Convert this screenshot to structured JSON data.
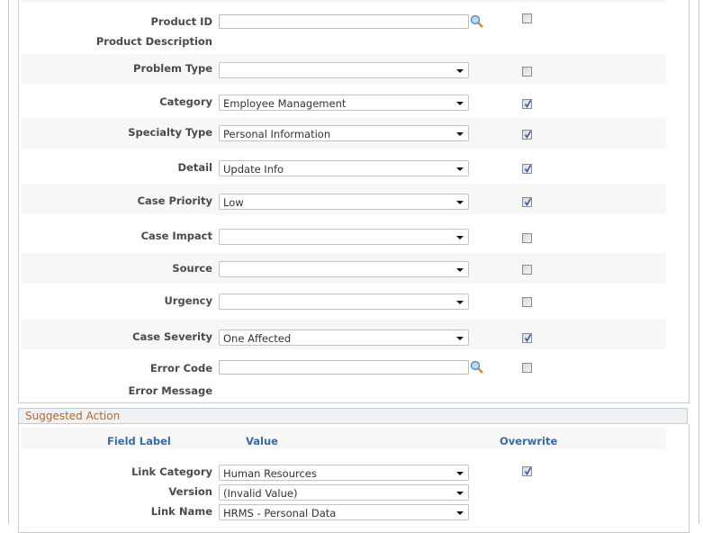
{
  "form": {
    "rows": [
      {
        "label": "Product ID",
        "type": "lookup",
        "value": "",
        "checked": false
      },
      {
        "label": "Product Description",
        "type": "text"
      },
      {
        "label": "Problem Type",
        "type": "select",
        "value": "",
        "checked": false
      },
      {
        "label": "Category",
        "type": "select",
        "value": "Employee Management",
        "checked": true
      },
      {
        "label": "Specialty Type",
        "type": "select",
        "value": "Personal Information",
        "checked": true
      },
      {
        "label": "Detail",
        "type": "select",
        "value": "Update Info",
        "checked": true
      },
      {
        "label": "Case Priority",
        "type": "select",
        "value": "Low",
        "checked": true
      },
      {
        "label": "Case Impact",
        "type": "select",
        "value": "",
        "checked": false
      },
      {
        "label": "Source",
        "type": "select",
        "value": "",
        "checked": false
      },
      {
        "label": "Urgency",
        "type": "select",
        "value": "",
        "checked": false
      },
      {
        "label": "Case Severity",
        "type": "select",
        "value": "One Affected",
        "checked": true
      },
      {
        "label": "Error Code",
        "type": "lookup",
        "value": "",
        "checked": false
      },
      {
        "label": "Error Message",
        "type": "text"
      }
    ]
  },
  "suggested_action": {
    "title": "Suggested Action",
    "columns": {
      "field_label": "Field Label",
      "value": "Value",
      "overwrite": "Overwrite"
    },
    "rows": [
      {
        "label": "Link Category",
        "value": "Human Resources",
        "checked": true
      },
      {
        "label": "Version",
        "value": "(Invalid Value)"
      },
      {
        "label": "Link Name",
        "value": "HRMS - Personal Data"
      }
    ]
  },
  "icons": {
    "lookup": "magnifier-lookup-icon",
    "dropdown": "chevron-down-icon",
    "check": "checkmark-icon"
  }
}
